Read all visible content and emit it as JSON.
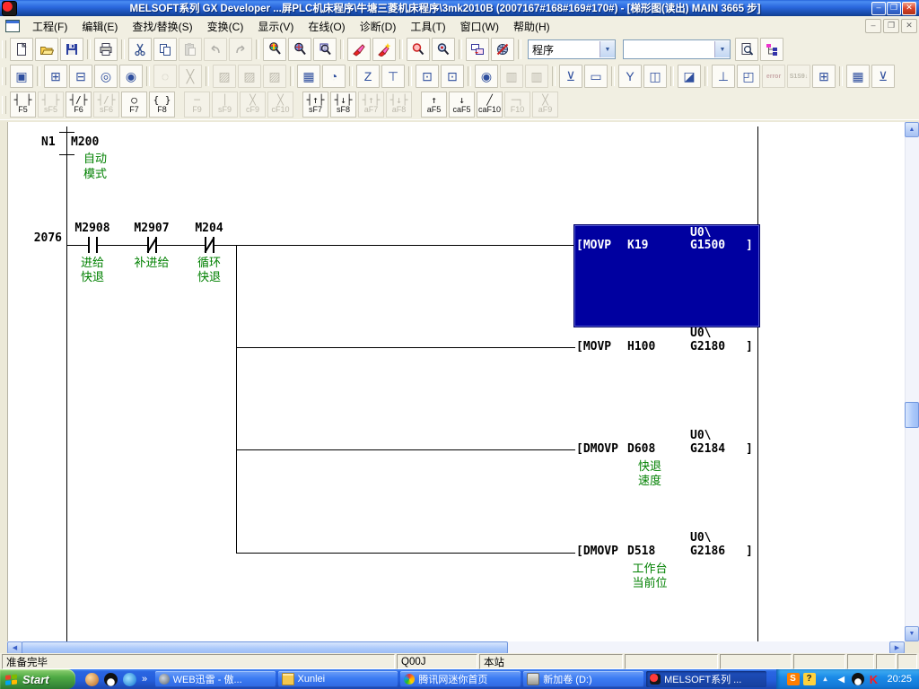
{
  "titlebar": {
    "title": "MELSOFT系列 GX Developer ...屏PLC机床程序\\牛塘三菱机床程序\\3mk2010B    (2007167#168#169#170#) - [梯形图(读出)    MAIN    3665 步]",
    "min": "–",
    "max": "❐",
    "close": "✕"
  },
  "menubar": {
    "items": [
      "工程(F)",
      "编辑(E)",
      "查找/替换(S)",
      "变换(C)",
      "显示(V)",
      "在线(O)",
      "诊断(D)",
      "工具(T)",
      "窗口(W)",
      "帮助(H)"
    ],
    "child_min": "–",
    "child_restore": "❐",
    "child_close": "✕"
  },
  "toolbar1": {
    "program_combo": "程序",
    "find_combo": ""
  },
  "toolbar2": {
    "glyphs": [
      "▣",
      "⊞",
      "⊟",
      "◎",
      "◉",
      "◌",
      "╳",
      "▨",
      "▨",
      "▨",
      "▦",
      "◔",
      "Z",
      "⊤",
      "⊡",
      "⊡",
      "◉",
      "▥",
      "▥",
      "⊻",
      "▭",
      "Y",
      "◫",
      "◪",
      "⊥",
      "◰",
      "error",
      "S1S9↓",
      "⊞",
      "▦",
      "⊻"
    ]
  },
  "ladder_toolbar": {
    "buttons": [
      {
        "sym": "┤ ├",
        "key": "F5"
      },
      {
        "sym": "┤ ├",
        "key": "sF5"
      },
      {
        "sym": "┤/├",
        "key": "F6"
      },
      {
        "sym": "┤/├",
        "key": "sF6"
      },
      {
        "sym": "○",
        "key": "F7"
      },
      {
        "sym": "{ }",
        "key": "F8"
      },
      {
        "sym": "─",
        "key": "F9"
      },
      {
        "sym": "│",
        "key": "sF9"
      },
      {
        "sym": "╳",
        "key": "cF9"
      },
      {
        "sym": "╳",
        "key": "cF10"
      },
      {
        "sym": "┤↑├",
        "key": "sF7"
      },
      {
        "sym": "┤↓├",
        "key": "sF8"
      },
      {
        "sym": "┤↑├",
        "key": "aF7"
      },
      {
        "sym": "┤↓├",
        "key": "aF8"
      },
      {
        "sym": "↑",
        "key": "aF5"
      },
      {
        "sym": "↓",
        "key": "caF5"
      },
      {
        "sym": "╱",
        "key": "caF10"
      },
      {
        "sym": "─┐",
        "key": "F10"
      },
      {
        "sym": "╳",
        "key": "aF9"
      }
    ]
  },
  "ladder": {
    "mc": {
      "nest": "N1",
      "device": "M200",
      "comment1": "自动",
      "comment2": "模式"
    },
    "step_no": "2076",
    "contacts": [
      {
        "device": "M2908",
        "comment1": "进给",
        "comment2": "快退"
      },
      {
        "device": "M2907",
        "comment1": "补进给",
        "comment2": ""
      },
      {
        "device": "M204",
        "comment1": "循环",
        "comment2": "快退"
      }
    ],
    "rows": [
      {
        "opcode": "[MOVP",
        "operand": "K19",
        "prefix": "U0\\",
        "dest": "G1500",
        "close": "]",
        "comment1": "",
        "comment2": ""
      },
      {
        "opcode": "[MOVP",
        "operand": "H100",
        "prefix": "U0\\",
        "dest": "G2180",
        "close": "]",
        "comment1": "",
        "comment2": ""
      },
      {
        "opcode": "[DMOVP",
        "operand": "D608",
        "prefix": "U0\\",
        "dest": "G2184",
        "close": "]",
        "comment1": "快退",
        "comment2": "速度"
      },
      {
        "opcode": "[DMOVP",
        "operand": "D518",
        "prefix": "U0\\",
        "dest": "G2186",
        "close": "]",
        "comment1": "工作台",
        "comment2": "当前位"
      }
    ]
  },
  "statusbar": {
    "ready": "准备完毕",
    "cpu": "Q00J",
    "station": "本站"
  },
  "taskbar": {
    "start": "Start",
    "chevron": "»",
    "tasks": [
      {
        "label": "WEB迅雷 - 傲..."
      },
      {
        "label": "Xunlei"
      },
      {
        "label": "腾讯网迷你首页"
      },
      {
        "label": "新加卷 (D:)"
      },
      {
        "label": "MELSOFT系列 ..."
      }
    ],
    "tray_s": "S",
    "tray_help": "?",
    "tray_k": "K",
    "clock": "20:25"
  }
}
